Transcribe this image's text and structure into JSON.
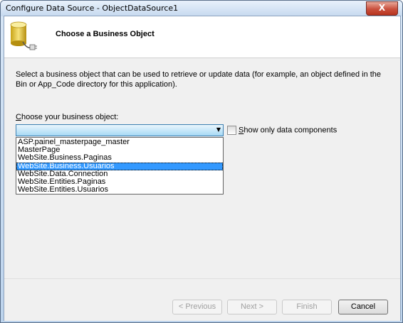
{
  "window": {
    "title": "Configure Data Source - ObjectDataSource1",
    "close_glyph": "X"
  },
  "header": {
    "title": "Choose a Business Object",
    "icon": "database-connector-icon"
  },
  "body": {
    "description": "Select a business object that can be used to retrieve or update data (for example, an object defined in the Bin or App_Code directory for this application).",
    "choose_label_prefix": "C",
    "choose_label_rest": "hoose your business object:",
    "combo_value": "",
    "dropdown_items": [
      "ASP.painel_masterpage_master",
      "MasterPage",
      "WebSite.Business.Paginas",
      "WebSite.Business.Usuarios",
      "WebSite.Data.Connection",
      "WebSite.Entities.Paginas",
      "WebSite.Entities.Usuarios"
    ],
    "selected_index": 3,
    "checkbox_label_prefix": "S",
    "checkbox_label_rest": "how only data components",
    "checkbox_checked": false
  },
  "footer": {
    "previous": "< Previous",
    "next": "Next >",
    "finish": "Finish",
    "cancel": "Cancel"
  },
  "colors": {
    "selection": "#3399ff",
    "combo_border": "#3c7fb1"
  }
}
